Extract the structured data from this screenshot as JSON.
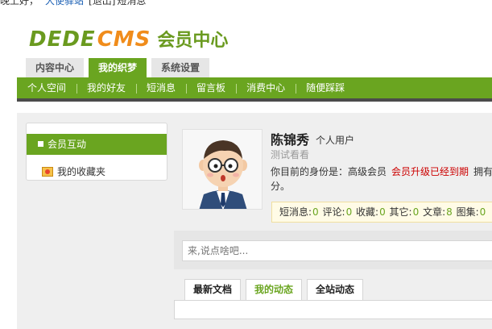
{
  "topbar": {
    "greeting": "晚上好，",
    "site_link": "大使驿站",
    "logout": "[退出]",
    "messages": "短消息"
  },
  "header": {
    "logo_dede": "DEDE",
    "logo_cms": "CMS",
    "logo_member": "会员中心"
  },
  "main_tabs": [
    {
      "label": "内容中心",
      "active": false
    },
    {
      "label": "我的织梦",
      "active": true
    },
    {
      "label": "系统设置",
      "active": false
    }
  ],
  "nav": {
    "items": [
      "个人空间",
      "我的好友",
      "短消息",
      "留言板",
      "消费中心",
      "随便踩踩"
    ]
  },
  "sidebar": {
    "section": "会员互动",
    "item": "我的收藏夹"
  },
  "profile": {
    "name": "陈锦秀",
    "type": "个人用户",
    "signature": "测试看看",
    "role_prefix": "你目前的身份是：高级会员",
    "role_expired": "会员升级已经到期",
    "role_tail": "拥有",
    "role_line2": "分。"
  },
  "stats": {
    "sms_label": "短消息:",
    "sms": "0",
    "comment_label": "评论:",
    "comment": "0",
    "fav_label": "收藏:",
    "fav": "0",
    "other_label": "其它:",
    "other": "0",
    "article_label": "文章:",
    "article": "8",
    "image_label": "图集:",
    "image": "0"
  },
  "talk": {
    "placeholder": "来,说点啥吧..."
  },
  "feed_tabs": [
    {
      "label": "最新文档",
      "active": false
    },
    {
      "label": "我的动态",
      "active": true
    },
    {
      "label": "全站动态",
      "active": false
    }
  ],
  "colors": {
    "brand_green": "#6aa520",
    "brand_orange": "#f08c1b",
    "expired_red": "#cc0000"
  }
}
